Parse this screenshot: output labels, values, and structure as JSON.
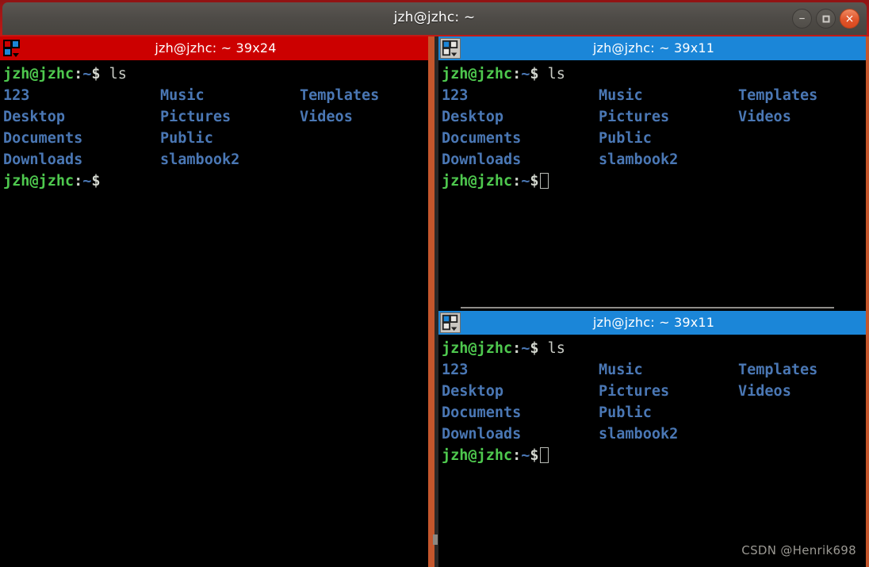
{
  "window": {
    "title": "jzh@jzhc: ~",
    "controls": {
      "minimize": "–",
      "maximize": "",
      "close": "×"
    }
  },
  "watermark": "CSDN @Henrik698",
  "terminal": {
    "prompt": {
      "user_host": "jzh@jzhc",
      "colon": ":",
      "path": "~",
      "sigil": "$"
    },
    "command": "ls",
    "listing_rows": [
      [
        "123",
        "Music",
        "Templates"
      ],
      [
        "Desktop",
        "Pictures",
        "Videos"
      ],
      [
        "Documents",
        "Public",
        ""
      ],
      [
        "Downloads",
        "slambook2",
        ""
      ]
    ]
  },
  "panes": [
    {
      "id": "left",
      "title": "jzh@jzhc: ~ 39x24",
      "state": "active",
      "icon": "split-pane-icon",
      "has_cursor": false
    },
    {
      "id": "top-right",
      "title": "jzh@jzhc: ~ 39x11",
      "state": "inactive",
      "icon": "split-pane-icon",
      "has_cursor": true
    },
    {
      "id": "bottom-right",
      "title": "jzh@jzhc: ~ 39x11",
      "state": "inactive",
      "icon": "split-pane-icon",
      "has_cursor": true
    }
  ],
  "colors": {
    "active_pane_header": "#cc0000",
    "inactive_pane_header": "#1b86d8",
    "divider": "#c4562c",
    "prompt_green": "#4ec84e",
    "listing_blue": "#4a77b4",
    "background": "#000000"
  }
}
